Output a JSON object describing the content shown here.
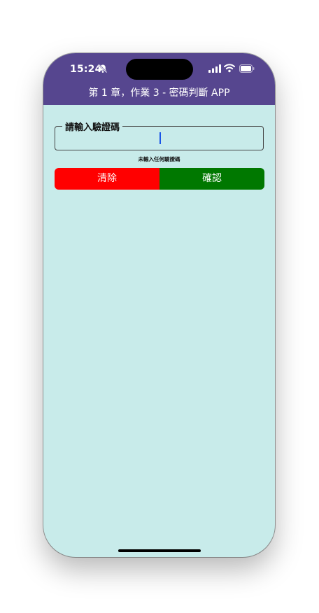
{
  "status_bar": {
    "time": "15:24",
    "icons": [
      "bell-slash-icon",
      "signal-icon",
      "wifi-icon",
      "battery-icon"
    ]
  },
  "app_bar": {
    "title": "第 1 章，作業 3 - 密碼判斷 APP"
  },
  "verification": {
    "label": "請輸入驗證碼",
    "value": "",
    "hint": "未輸入任何驗證碼"
  },
  "actions": {
    "clear_label": "清除",
    "confirm_label": "確認"
  },
  "colors": {
    "app_bar": "#56468f",
    "background": "#c8ebea",
    "clear_button": "#ff0000",
    "confirm_button": "#007800",
    "caret": "#1a55e8"
  }
}
